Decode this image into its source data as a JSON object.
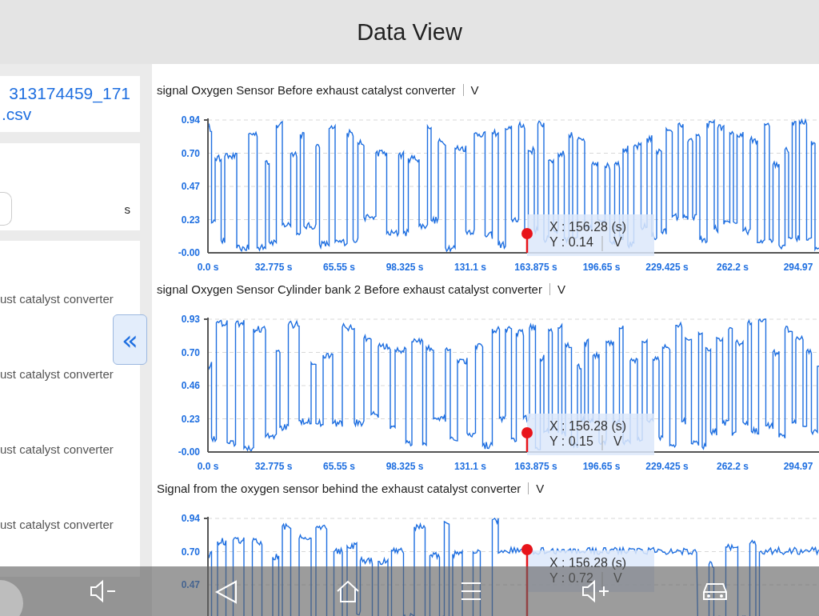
{
  "header": {
    "title": "Data View"
  },
  "sidebar": {
    "file_name_lines": [
      "313174459_171",
      ".csv"
    ],
    "time_unit": "s",
    "items": [
      "ust catalyst converter",
      "ust catalyst converter",
      "ust catalyst converter",
      "ust catalyst converter"
    ],
    "collapse_button": "«"
  },
  "charts": [
    {
      "title": "signal Oxygen Sensor Before exhaust catalyst converter",
      "unit": "V",
      "kind": "switching",
      "y_ticks": [
        "0.94",
        "0.70",
        "0.47",
        "0.23",
        "-0.00"
      ],
      "x_ticks": [
        "0.0 s",
        "32.775 s",
        "65.55 s",
        "98.325 s",
        "131.1 s",
        "163.875 s",
        "196.65 s",
        "229.425 s",
        "262.2 s",
        "294.97"
      ],
      "cursor": {
        "x": "X : 156.28 (s)",
        "y": "Y : 0.14",
        "unit": "V"
      }
    },
    {
      "title": "signal Oxygen Sensor Cylinder bank 2 Before exhaust catalyst converter",
      "unit": "V",
      "kind": "switching",
      "y_ticks": [
        "0.93",
        "0.70",
        "0.46",
        "0.23",
        "-0.00"
      ],
      "x_ticks": [
        "0.0 s",
        "32.775 s",
        "65.55 s",
        "98.325 s",
        "131.1 s",
        "163.875 s",
        "196.65 s",
        "229.425 s",
        "262.2 s",
        "294.97"
      ],
      "cursor": {
        "x": "X : 156.28 (s)",
        "y": "Y : 0.15",
        "unit": "V"
      }
    },
    {
      "title": "Signal from the oxygen sensor behind the exhaust catalyst converter",
      "unit": "V",
      "kind": "settling",
      "y_ticks": [
        "0.94",
        "0.70",
        "0.47"
      ],
      "cursor": {
        "x": "X : 156.28 (s)",
        "y": "Y : 0.72",
        "unit": "V"
      }
    }
  ]
}
